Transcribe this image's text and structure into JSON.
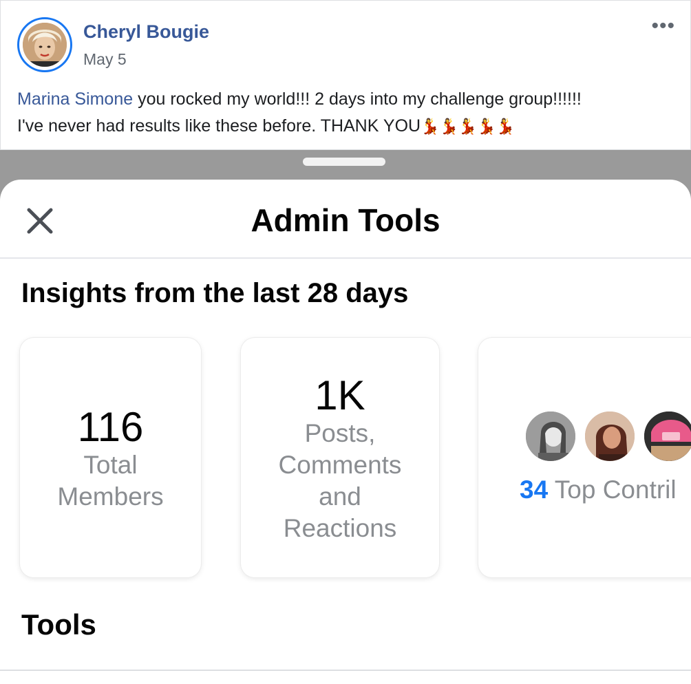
{
  "post": {
    "author": "Cheryl Bougie",
    "date": "May 5",
    "more_label": "•••",
    "mention": "Marina Simone",
    "text_line1": " you rocked my world!!! 2 days into my challenge group!!!!!!",
    "text_line2": "I've never had results like these before. THANK YOU",
    "emoji": "💃💃💃💃💃"
  },
  "sheet": {
    "title": "Admin Tools",
    "close_icon": "close-icon",
    "insights_title": "Insights from the last 28 days",
    "tools_title": "Tools"
  },
  "cards": {
    "members": {
      "value": "116",
      "label_line1": "Total",
      "label_line2": "Members"
    },
    "activity": {
      "value": "1K",
      "label_line1": "Posts,",
      "label_line2": "Comments",
      "label_line3": "and",
      "label_line4": "Reactions"
    },
    "contributors": {
      "count": "34",
      "label": " Top Contril"
    }
  },
  "colors": {
    "link": "#385898",
    "accent": "#1877f2",
    "backdrop": "#9a9a9a"
  }
}
